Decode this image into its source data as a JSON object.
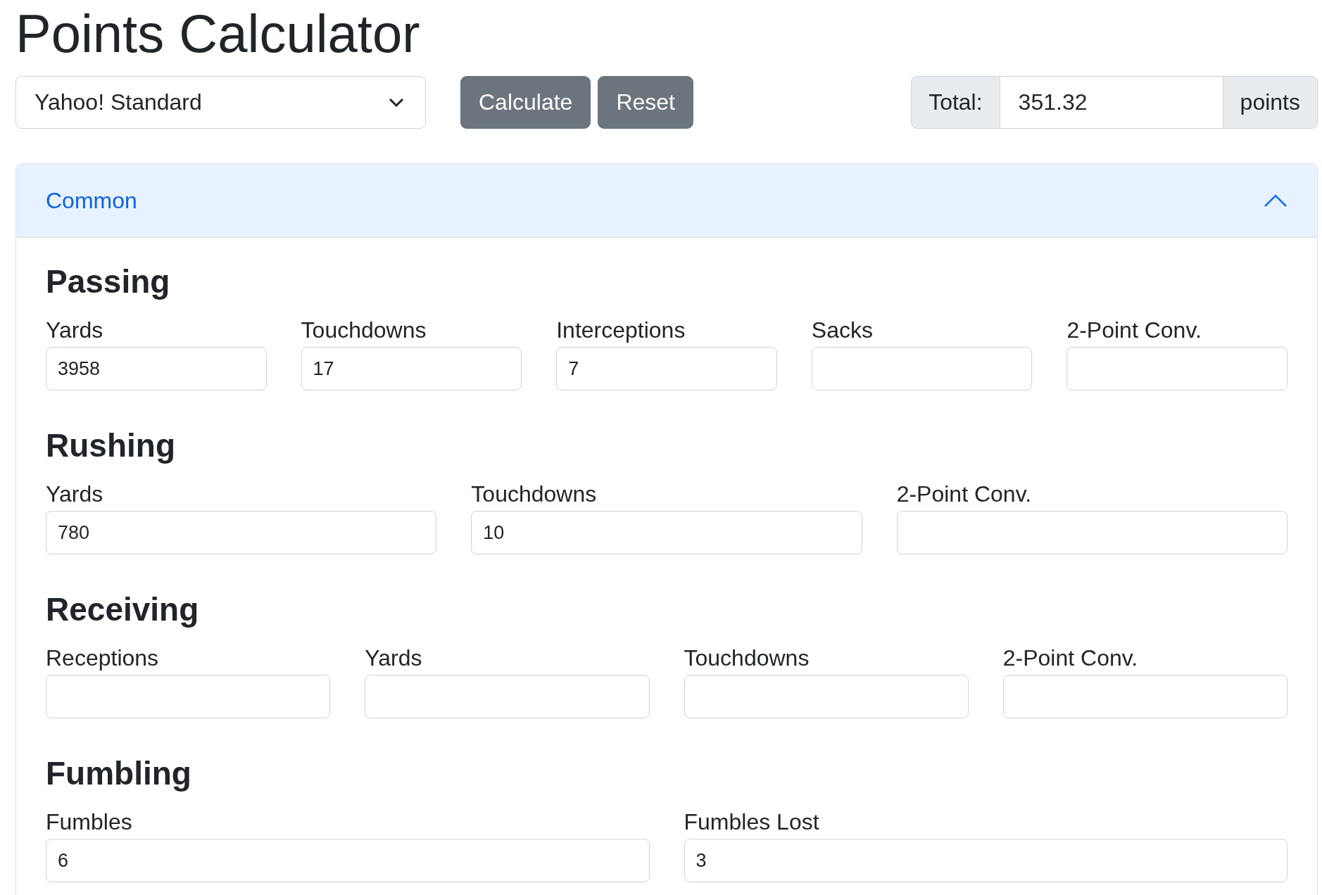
{
  "title": "Points Calculator",
  "preset": {
    "value": "Yahoo! Standard"
  },
  "buttons": [
    {
      "label": "Calculate"
    },
    {
      "label": "Reset"
    }
  ],
  "total": {
    "prefix": "Total:",
    "value": "351.32",
    "suffix": "points"
  },
  "accordion": {
    "title": "Common",
    "expanded": true,
    "sections": [
      {
        "heading": "Passing",
        "fields": [
          {
            "label": "Yards",
            "value": "3958"
          },
          {
            "label": "Touchdowns",
            "value": "17"
          },
          {
            "label": "Interceptions",
            "value": "7"
          },
          {
            "label": "Sacks"
          },
          {
            "label": "2-Point Conv."
          }
        ]
      },
      {
        "heading": "Rushing",
        "fields": [
          {
            "label": "Yards",
            "value": "780"
          },
          {
            "label": "Touchdowns",
            "value": "10"
          },
          {
            "label": "2-Point Conv."
          }
        ]
      },
      {
        "heading": "Receiving",
        "fields": [
          {
            "label": "Receptions"
          },
          {
            "label": "Yards"
          },
          {
            "label": "Touchdowns"
          },
          {
            "label": "2-Point Conv."
          }
        ]
      },
      {
        "heading": "Fumbling",
        "fields": [
          {
            "label": "Fumbles",
            "value": "6"
          },
          {
            "label": "Fumbles Lost",
            "value": "3"
          }
        ]
      }
    ]
  }
}
